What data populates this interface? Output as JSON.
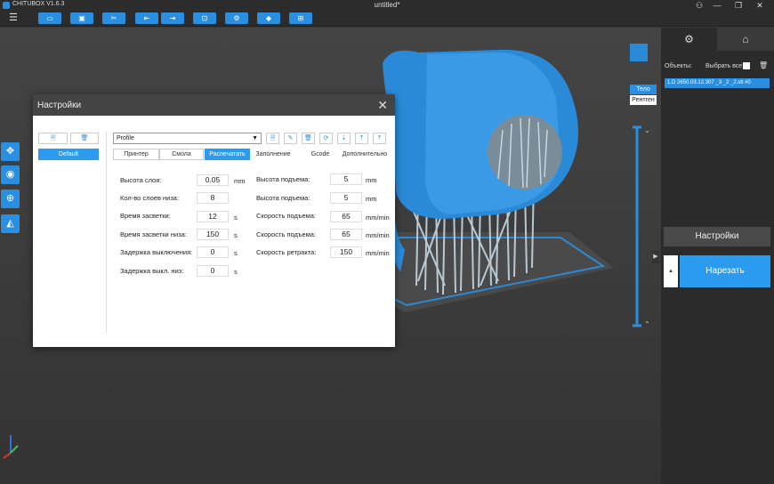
{
  "app": {
    "name": "CHITUBOX V1.6.3",
    "document_title": "untitled*"
  },
  "window": {
    "user": "⚇",
    "minimize": "—",
    "restore": "❐",
    "close": "✕"
  },
  "toolbar": {
    "menu": "☰",
    "buttons": [
      "▭",
      "▣",
      "✂",
      "⇤",
      "⇥",
      "⊡",
      "⚙",
      "◆",
      "⊞"
    ]
  },
  "left_tools": [
    "✥",
    "◉",
    "⊕",
    "◭"
  ],
  "view_modes": {
    "body": "Тело",
    "xray": "Рентген"
  },
  "right_panel": {
    "tabs": [
      "⚙",
      "⌂"
    ],
    "objects_label": "Объекты:",
    "select_all": "Выбрать все",
    "delete_icon": "🗑",
    "object_item": "1.D 2650.03.12.307 _3 _2 _2.stl #0",
    "settings_button": "Настройки",
    "slice_side": "▴",
    "slice_button": "Нарезать"
  },
  "dialog": {
    "title": "Настройки",
    "close": "✕",
    "left_buttons": [
      "🗎",
      "🗑"
    ],
    "default_item": "Default",
    "profile": {
      "value": "Profile",
      "arrow": "▼"
    },
    "profile_buttons": [
      "🗎",
      "✎",
      "🗑",
      "⟳",
      "⇣",
      "⇡",
      "⤒"
    ],
    "tabs": [
      "Принтер",
      "Смола",
      "Распечатать",
      "Заполнение",
      "Gcode",
      "Дополнительно"
    ],
    "active_tab": "Распечатать",
    "left_fields": [
      {
        "label": "Высота слоя:",
        "value": "0.05",
        "unit": "mm"
      },
      {
        "label": "Кол-во слоев низа:",
        "value": "8",
        "unit": ""
      },
      {
        "label": "Время засветки:",
        "value": "12",
        "unit": "s"
      },
      {
        "label": "Время засветки низа:",
        "value": "150",
        "unit": "s"
      },
      {
        "label": "Задержка выключения:",
        "value": "0",
        "unit": "s"
      },
      {
        "label": "Задержка выкл. низ:",
        "value": "0",
        "unit": "s"
      }
    ],
    "right_fields": [
      {
        "label": "Высота подъема:",
        "value": "5",
        "unit": "mm"
      },
      {
        "label": "Высота подъема:",
        "value": "5",
        "unit": "mm"
      },
      {
        "label": "Скорость подъема:",
        "value": "65",
        "unit": "mm/min"
      },
      {
        "label": "Скорость подъема:",
        "value": "65",
        "unit": "mm/min"
      },
      {
        "label": "Скорость ретракта:",
        "value": "150",
        "unit": "mm/min"
      }
    ]
  },
  "colors": {
    "accent": "#2a9bef",
    "model": "#2b8ad8",
    "dark": "#2b2b2b"
  }
}
